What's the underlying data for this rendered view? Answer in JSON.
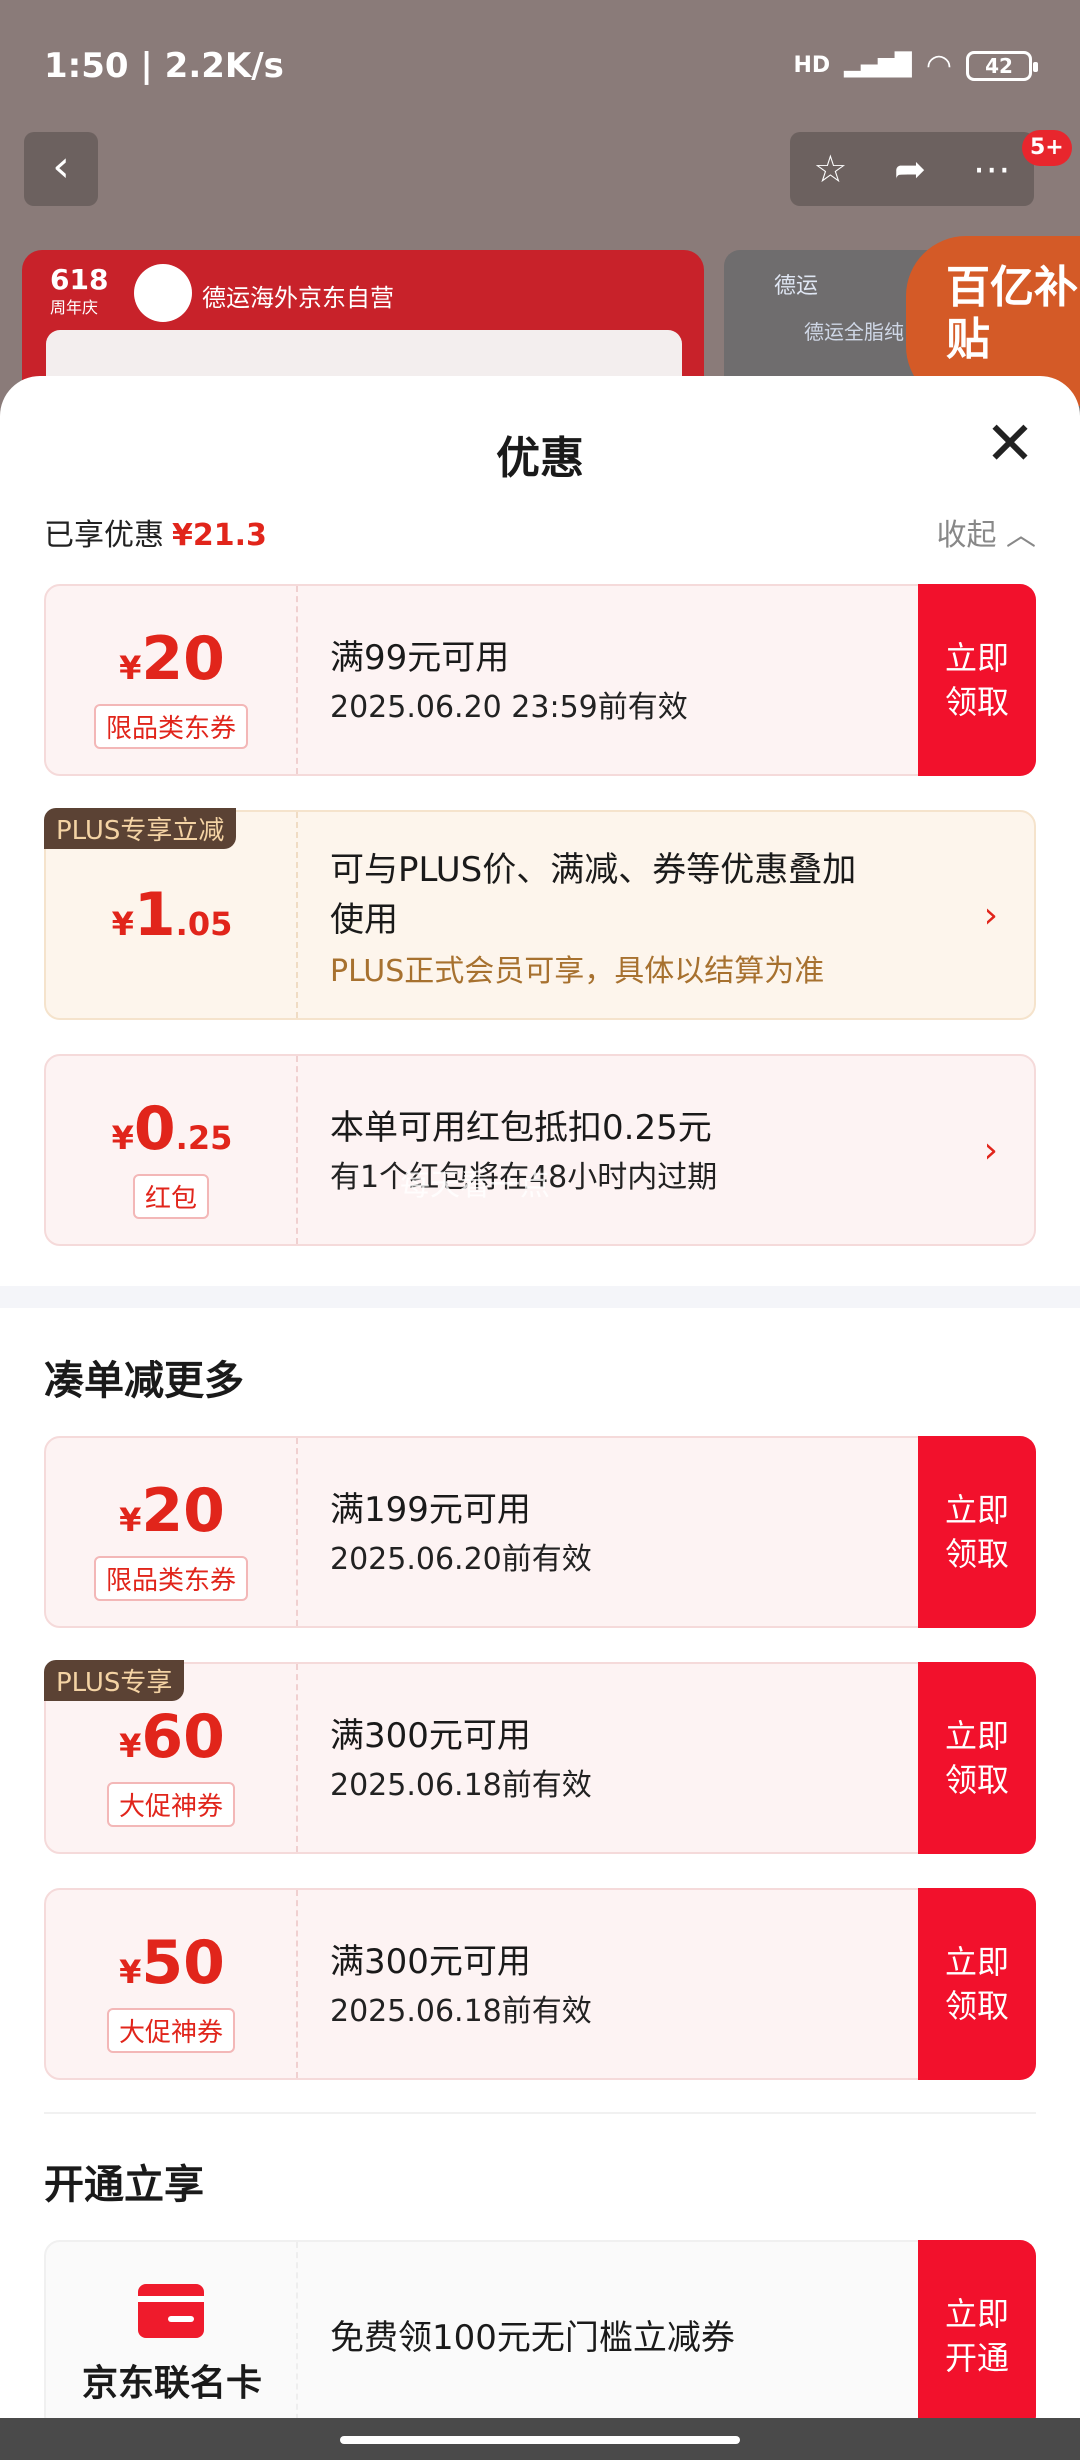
{
  "status_bar": {
    "time": "1:50 | 2.2K/s",
    "signal": "HD",
    "battery": "42"
  },
  "header": {
    "badge": "5+"
  },
  "background": {
    "store_618": "618",
    "store_618_sub": "周年庆",
    "store_name": "德运海外京东自营",
    "side_brand": "德运",
    "side_product": "德运全脂纯",
    "subsidy": "百亿补贴"
  },
  "sheet": {
    "title": "优惠",
    "enjoyed_label": "已享优惠",
    "enjoyed_amount": "¥21.3",
    "collapse_label": "收起"
  },
  "coupons": [
    {
      "cur": "¥",
      "big": "20",
      "dec": "",
      "tag": "限品类东券",
      "line1": "满99元可用",
      "line2": "2025.06.20 23:59前有效",
      "button": "立即领取"
    },
    {
      "corner": "PLUS专享立减",
      "cur": "¥",
      "big": "1",
      "dec": ".05",
      "line1": "可与PLUS价、满减、券等优惠叠加",
      "line1b": "使用",
      "line2": "PLUS正式会员可享，具体以结算为准"
    },
    {
      "cur": "¥",
      "big": "0",
      "dec": ".25",
      "tag": "红包",
      "line1": "本单可用红包抵扣0.25元",
      "line2": "有1个红包将在48小时内过期"
    }
  ],
  "section_more": {
    "title": "凑单减更多",
    "coupons": [
      {
        "cur": "¥",
        "big": "20",
        "tag": "限品类东券",
        "line1": "满199元可用",
        "line2": "2025.06.20前有效",
        "button": "立即领取"
      },
      {
        "corner": "PLUS专享",
        "cur": "¥",
        "big": "60",
        "tag": "大促神券",
        "line1": "满300元可用",
        "line2": "2025.06.18前有效",
        "button": "立即领取"
      },
      {
        "cur": "¥",
        "big": "50",
        "tag": "大促神券",
        "line1": "满300元可用",
        "line2": "2025.06.18前有效",
        "button": "立即领取"
      }
    ]
  },
  "section_open": {
    "title": "开通立享",
    "card_name": "京东联名卡",
    "line1": "免费领100元无门槛立减券",
    "button": "立即开通"
  },
  "watermark": "每天看一点"
}
